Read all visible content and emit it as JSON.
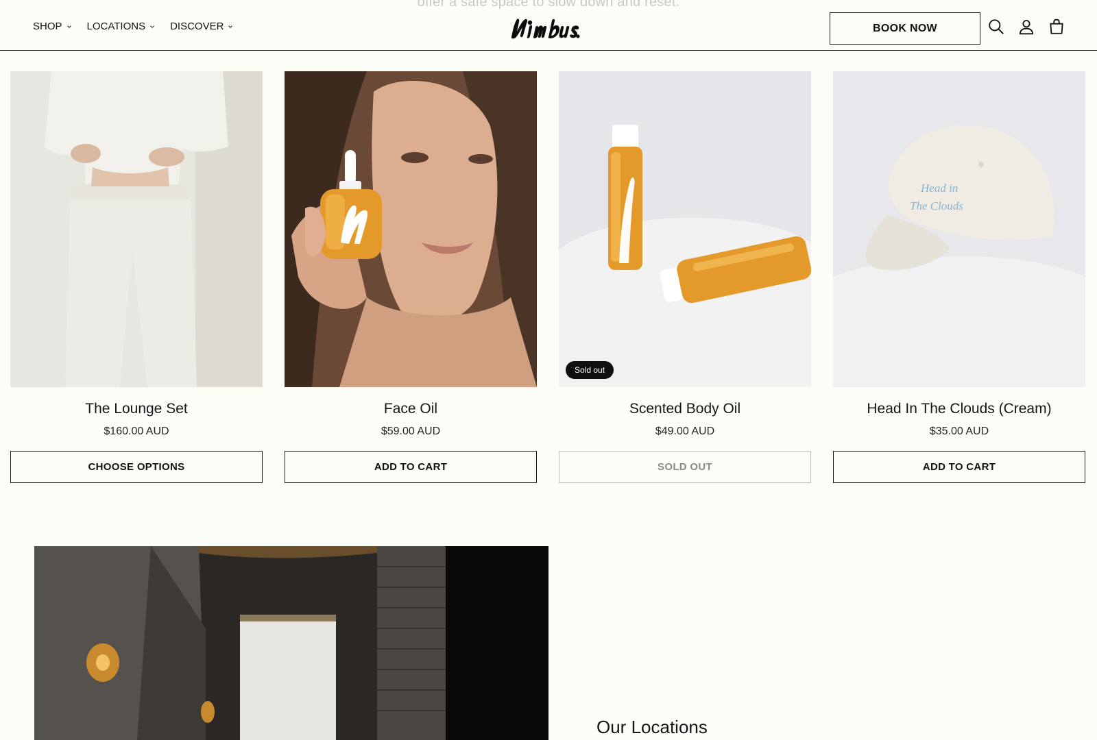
{
  "top_text": "offer a safe space to slow down and reset.",
  "header": {
    "nav": [
      {
        "label": "SHOP"
      },
      {
        "label": "LOCATIONS"
      },
      {
        "label": "DISCOVER"
      }
    ],
    "logo_text": "Nimbus",
    "book_label": "BOOK NOW",
    "icons": [
      "search-icon",
      "account-icon",
      "cart-icon"
    ]
  },
  "products": [
    {
      "title": "The Lounge Set",
      "price": "$160.00 AUD",
      "button": "CHOOSE OPTIONS",
      "badge": "",
      "disabled": false
    },
    {
      "title": "Face Oil",
      "price": "$59.00 AUD",
      "button": "ADD TO CART",
      "badge": "",
      "disabled": false
    },
    {
      "title": "Scented Body Oil",
      "price": "$49.00 AUD",
      "button": "SOLD OUT",
      "badge": "Sold out",
      "disabled": true
    },
    {
      "title": "Head In The Clouds (Cream)",
      "price": "$35.00 AUD",
      "button": "ADD TO CART",
      "badge": "",
      "disabled": false
    }
  ],
  "cap_text": [
    "Head in",
    "The Clouds"
  ],
  "locations": {
    "title": "Our Locations"
  },
  "colors": {
    "background": "#fdfdf8",
    "text": "#111111",
    "badge": "#0f0f0f",
    "oil": "#e39a2a"
  }
}
